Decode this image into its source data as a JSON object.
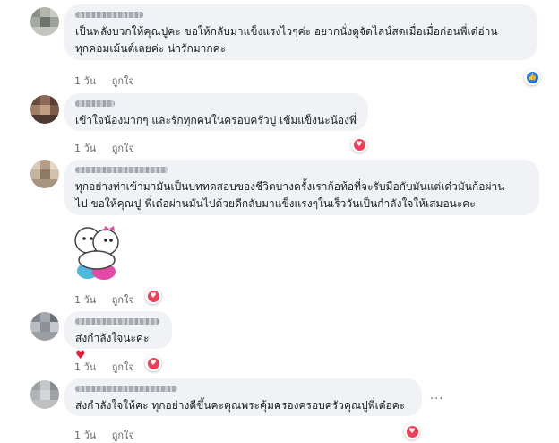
{
  "comments": [
    {
      "text": "เป็นพลังบวกให้คุณปูคะ ขอให้กลับมาแข็งแรงไวๆค่ะ อยากนั่งดูจัดไลน์สดเมื่อเมื่อก่อนพี่เด๋อ่าน\nทุกคอมเม้นต์เลยค่ะ น่ารักมากคะ",
      "time": "1 วัน",
      "like": "ถูกใจ",
      "reaction": "like"
    },
    {
      "text": "เข้าใจน้องมากๆ และรักทุกคนในครอบครัวปู เข้มแข็งนะน้องพี่",
      "time": "1 วัน",
      "like": "ถูกใจ",
      "reaction": "love"
    },
    {
      "text": "ทุกอย่างท่าเข้ามามันเป็นบททดสอบของชีวิตบางครั้งเราก้อท้อที่จะรับมือกับมันแต่เด๋วมันก้อผ่าน\nไป ขอให้คุณปู-พี่เด๋อผ่านมันไปด้วยดีกลับมาแข็งแรงๆในเร็ววันเป็นกำลังใจให้เสมอนะคะ",
      "time": "1 วัน",
      "like": "ถูกใจ",
      "reaction": "love",
      "sticker": "hugging-sticker"
    },
    {
      "text": "ส่งกำลังใจนะคะ",
      "emoji": "♥",
      "time": "1 วัน",
      "like": "ถูกใจ",
      "reaction": "love"
    },
    {
      "text": "ส่งกำลังใจให้คะ ทุกอย่างดีขึ้นคะคุณพระคุ้มครองครอบครัวคุณปูพี่เด๋อคะ",
      "time": "1 วัน",
      "like": "ถูกใจ",
      "reaction": "love",
      "more": "..."
    }
  ],
  "colors": {
    "bubble": "#f0f2f5",
    "meta": "#65676b",
    "love": "#f33e58",
    "like": "#1877f2"
  }
}
